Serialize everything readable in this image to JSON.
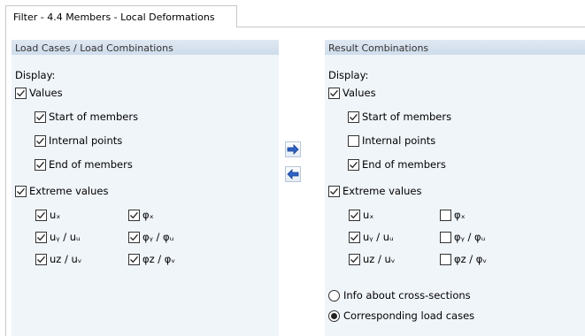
{
  "tab": {
    "label": "Filter - 4.4 Members - Local Deformations"
  },
  "left": {
    "header": "Load Cases / Load Combinations",
    "display_label": "Display:",
    "values_label": "Values",
    "start_label": "Start of members",
    "internal_label": "Internal points",
    "end_label": "End of members",
    "extreme_label": "Extreme values",
    "ux": "uₓ",
    "uy": "uᵧ / uᵤ",
    "uz": "uz / uᵥ",
    "phix": "φₓ",
    "phiy": "φᵧ / φᵤ",
    "phiz": "φz / φᵥ",
    "checked": {
      "values": true,
      "start": true,
      "internal": true,
      "end": true,
      "extreme": true,
      "ux": true,
      "uy": true,
      "uz": true,
      "phix": true,
      "phiy": true,
      "phiz": true
    }
  },
  "right": {
    "header": "Result Combinations",
    "display_label": "Display:",
    "values_label": "Values",
    "start_label": "Start of members",
    "internal_label": "Internal points",
    "end_label": "End of members",
    "extreme_label": "Extreme values",
    "ux": "uₓ",
    "uy": "uᵧ / uᵤ",
    "uz": "uz / uᵥ",
    "phix": "φₓ",
    "phiy": "φᵧ / φᵤ",
    "phiz": "φz / φᵥ",
    "radio_info": "Info about cross-sections",
    "radio_corresponding": "Corresponding load cases",
    "selected_radio": "corresponding",
    "checked": {
      "values": true,
      "start": true,
      "internal": false,
      "end": true,
      "extreme": true,
      "ux": true,
      "uy": true,
      "uz": true,
      "phix": false,
      "phiy": false,
      "phiz": false
    }
  },
  "buttons": {
    "copy_right_icon": "arrow-right-icon",
    "copy_left_icon": "arrow-left-icon"
  }
}
